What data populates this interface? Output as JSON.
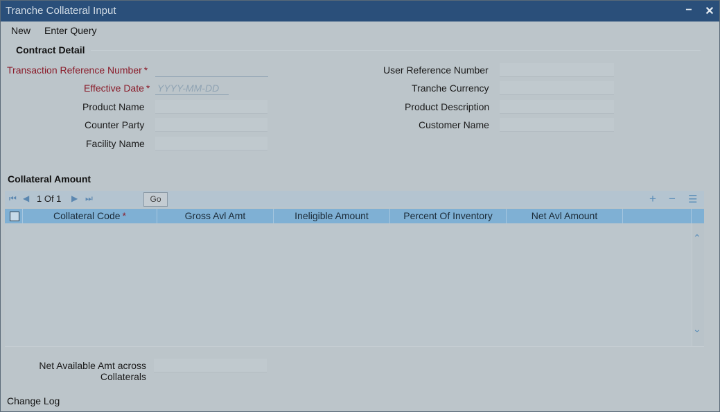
{
  "window": {
    "title": "Tranche Collateral Input",
    "minimize": "−",
    "close": "✕"
  },
  "menu": {
    "new": "New",
    "enter_query": "Enter Query"
  },
  "contract_detail": {
    "title": "Contract Detail",
    "transaction_reference_number": {
      "label": "Transaction Reference Number",
      "value": ""
    },
    "effective_date": {
      "label": "Effective Date",
      "placeholder": "YYYY-MM-DD"
    },
    "product_name": {
      "label": "Product Name",
      "value": ""
    },
    "counter_party": {
      "label": "Counter Party",
      "value": ""
    },
    "facility_name": {
      "label": "Facility Name",
      "value": ""
    },
    "user_reference_number": {
      "label": "User Reference Number",
      "value": ""
    },
    "tranche_currency": {
      "label": "Tranche Currency",
      "value": ""
    },
    "product_description": {
      "label": "Product Description",
      "value": ""
    },
    "customer_name": {
      "label": "Customer Name",
      "value": ""
    },
    "required_mark": "*"
  },
  "collateral_amount": {
    "title": "Collateral Amount",
    "pager": "1 Of 1",
    "go": "Go",
    "columns": [
      "Collateral Code",
      "Gross Avl Amt",
      "Ineligible Amount",
      "Percent Of Inventory",
      "Net Avl Amount"
    ],
    "rows": []
  },
  "net_available": {
    "label_line1": "Net Available Amt across",
    "label_line2": "Collaterals",
    "value": ""
  },
  "footer": {
    "change_log": "Change Log"
  },
  "icons": {
    "first": "first-page-icon",
    "prev": "prev-page-icon",
    "next": "next-page-icon",
    "last": "last-page-icon",
    "add": "plus-icon",
    "remove": "minus-icon",
    "options": "list-options-icon"
  }
}
